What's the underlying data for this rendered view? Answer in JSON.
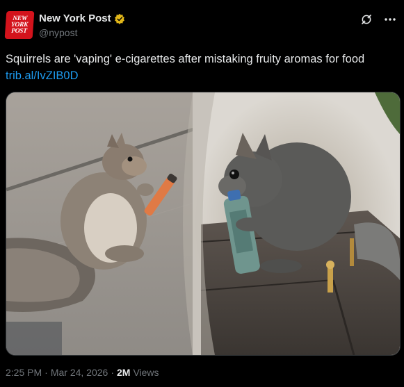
{
  "account": {
    "avatar_lines": [
      "NEW",
      "YORK",
      "POST"
    ],
    "name": "New York Post",
    "handle": "@nypost",
    "verified_badge": "gold-check-badge-icon"
  },
  "tweet": {
    "text": "Squirrels are 'vaping' e-cigarettes after mistaking fruity aromas for food",
    "link": "trib.al/IvZIB0D"
  },
  "media": {
    "images": [
      "squirrel-holding-orange-vape",
      "squirrel-holding-teal-vape"
    ]
  },
  "footer": {
    "time": "2:25 PM",
    "date": "Mar 24, 2026",
    "separator": "·",
    "views_count": "2M",
    "views_label": "Views"
  },
  "icons": {
    "grok": "grok-icon",
    "more": "more-options-icon"
  },
  "colors": {
    "background": "#000000",
    "link": "#1d9bf0",
    "muted": "#71767b",
    "brand_red": "#d3131c",
    "verified_gold": "#e2b719"
  }
}
